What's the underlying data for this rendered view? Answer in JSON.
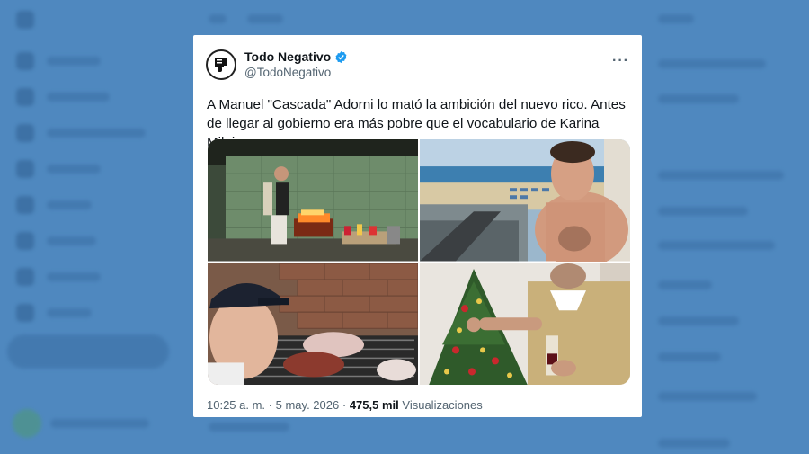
{
  "tweet": {
    "display_name": "Todo Negativo",
    "handle": "@TodoNegativo",
    "more_label": "···",
    "text": "A Manuel \"Cascada\" Adorni lo mató la ambición del nuevo rico. Antes de llegar al gobierno era más pobre que el vocabulario de Karina Milei.",
    "time": "10:25 a. m.",
    "separator": "·",
    "date": "5 may. 2026",
    "views_count": "475,5 mil",
    "views_label": "Visualizaciones"
  },
  "photos": [
    {
      "name": "photo-grill-night"
    },
    {
      "name": "photo-beach-balcony"
    },
    {
      "name": "photo-asado-cap"
    },
    {
      "name": "photo-christmas-tree"
    }
  ],
  "colors": {
    "verified": "#1d9bf0",
    "background": "#4f88bf",
    "text": "#0f1419",
    "secondary": "#536471"
  },
  "icons": {
    "verified": "verified-badge-icon",
    "more": "more-options-icon"
  }
}
